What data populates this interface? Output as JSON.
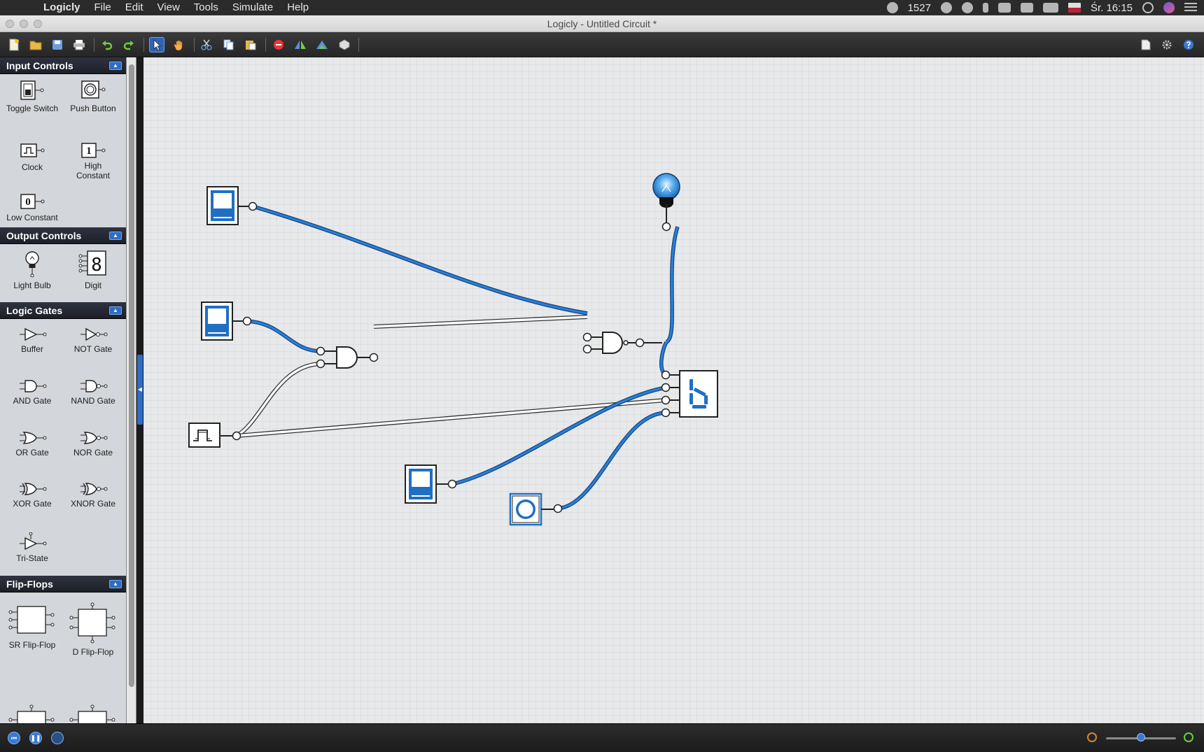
{
  "menubar": {
    "app_name": "Logicly",
    "items": [
      "File",
      "Edit",
      "View",
      "Tools",
      "Simulate",
      "Help"
    ],
    "status_number": "1527",
    "clock": "Śr. 16:15"
  },
  "window": {
    "title": "Logicly - Untitled Circuit *"
  },
  "toolbar": {
    "icons": [
      "new-file-icon",
      "open-folder-icon",
      "save-icon",
      "print-icon",
      "undo-icon",
      "redo-icon",
      "select-arrow-icon",
      "hand-pan-icon",
      "cut-icon",
      "copy-icon",
      "paste-icon",
      "delete-icon",
      "flip-horizontal-icon",
      "flip-vertical-icon",
      "create-ic-icon",
      "export-icon",
      "settings-gear-icon",
      "help-icon"
    ]
  },
  "sidebar": {
    "sections": [
      {
        "title": "Input Controls",
        "items": [
          "Toggle Switch",
          "Push Button",
          "Clock",
          "High Constant",
          "Low Constant"
        ]
      },
      {
        "title": "Output Controls",
        "items": [
          "Light Bulb",
          "Digit"
        ]
      },
      {
        "title": "Logic Gates",
        "items": [
          "Buffer",
          "NOT Gate",
          "AND Gate",
          "NAND Gate",
          "OR Gate",
          "NOR Gate",
          "XOR Gate",
          "XNOR Gate",
          "Tri-State"
        ]
      },
      {
        "title": "Flip-Flops",
        "items": [
          "SR Flip-Flop",
          "D Flip-Flop"
        ]
      }
    ],
    "glyph_text": {
      "high": "1",
      "low": "0",
      "digit": "8"
    }
  },
  "colors": {
    "accent": "#1f6fc5",
    "wire_on": "#1f6fc5",
    "wire_off": "#ffffff",
    "sidebar_header": "#23262f"
  }
}
